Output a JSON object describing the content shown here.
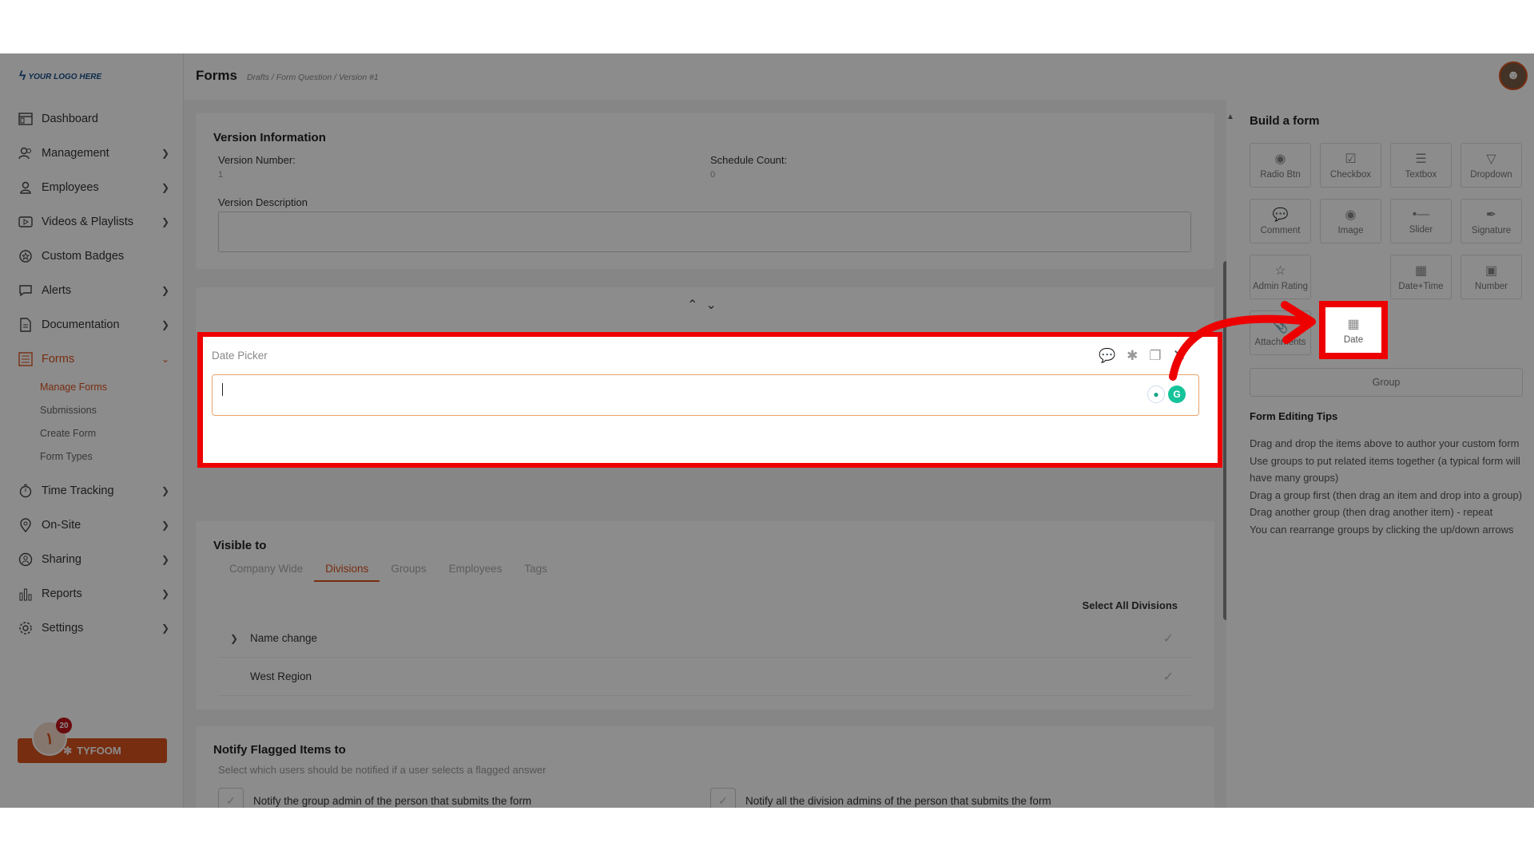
{
  "logo": {
    "text": "YOUR LOGO HERE"
  },
  "header": {
    "title": "Forms",
    "breadcrumb": "Drafts / Form Question / Version #1"
  },
  "sidebar": {
    "items": [
      {
        "label": "Dashboard",
        "icon": "dashboard-icon"
      },
      {
        "label": "Management",
        "icon": "people-icon"
      },
      {
        "label": "Employees",
        "icon": "person-icon"
      },
      {
        "label": "Videos & Playlists",
        "icon": "video-icon"
      },
      {
        "label": "Custom Badges",
        "icon": "badge-icon"
      },
      {
        "label": "Alerts",
        "icon": "chat-icon"
      },
      {
        "label": "Documentation",
        "icon": "document-icon"
      },
      {
        "label": "Forms",
        "icon": "list-icon"
      },
      {
        "label": "Time Tracking",
        "icon": "stopwatch-icon"
      },
      {
        "label": "On-Site",
        "icon": "location-pin-icon"
      },
      {
        "label": "Sharing",
        "icon": "share-icon"
      },
      {
        "label": "Reports",
        "icon": "bar-chart-icon"
      },
      {
        "label": "Settings",
        "icon": "gear-icon"
      }
    ],
    "forms_sub": [
      "Manage Forms",
      "Submissions",
      "Create Form",
      "Form Types"
    ],
    "tyfoom": {
      "label": "TYFOOM",
      "count": "20"
    }
  },
  "version": {
    "title": "Version Information",
    "number_label": "Version Number:",
    "number_value": "1",
    "schedule_label": "Schedule Count:",
    "schedule_value": "0",
    "description_label": "Version Description"
  },
  "date_picker": {
    "title": "Date Picker"
  },
  "visible": {
    "title": "Visible to",
    "tabs": [
      "Company Wide",
      "Divisions",
      "Groups",
      "Employees",
      "Tags"
    ],
    "active_tab": "Divisions",
    "select_all": "Select All Divisions",
    "rows": [
      "Name change",
      "West Region"
    ]
  },
  "notify": {
    "title": "Notify Flagged Items to",
    "subtitle": "Select which users should be notified if a user selects a flagged answer",
    "option1": "Notify the group admin of the person that submits the form",
    "option2": "Notify all the division admins of the person that submits the form"
  },
  "build": {
    "title": "Build a form",
    "tools": [
      {
        "label": "Radio Btn",
        "icon": "radio-icon"
      },
      {
        "label": "Checkbox",
        "icon": "checkbox-icon"
      },
      {
        "label": "Textbox",
        "icon": "textbox-icon"
      },
      {
        "label": "Dropdown",
        "icon": "dropdown-icon"
      },
      {
        "label": "Comment",
        "icon": "comment-icon"
      },
      {
        "label": "Image",
        "icon": "camera-icon"
      },
      {
        "label": "Slider",
        "icon": "slider-icon"
      },
      {
        "label": "Signature",
        "icon": "signature-icon"
      },
      {
        "label": "Admin Rating",
        "icon": "star-icon"
      },
      {
        "label": "Date",
        "icon": "calendar-icon"
      },
      {
        "label": "Date+Time",
        "icon": "calendar-clock-icon"
      },
      {
        "label": "Number",
        "icon": "number-icon"
      },
      {
        "label": "Attachments",
        "icon": "attachment-icon"
      }
    ],
    "group_label": "Group",
    "tips_title": "Form Editing Tips",
    "tips": [
      "Drag and drop the items above to author your custom form",
      "Use groups to put related items together (a typical form will have many groups)",
      "Drag a group first (then drag an item and drop into a group)",
      "Drag another group (then drag another item) - repeat",
      "You can rearrange groups by clicking the up/down arrows"
    ]
  },
  "colors": {
    "accent": "#d9531e",
    "highlight": "#ee0000"
  }
}
